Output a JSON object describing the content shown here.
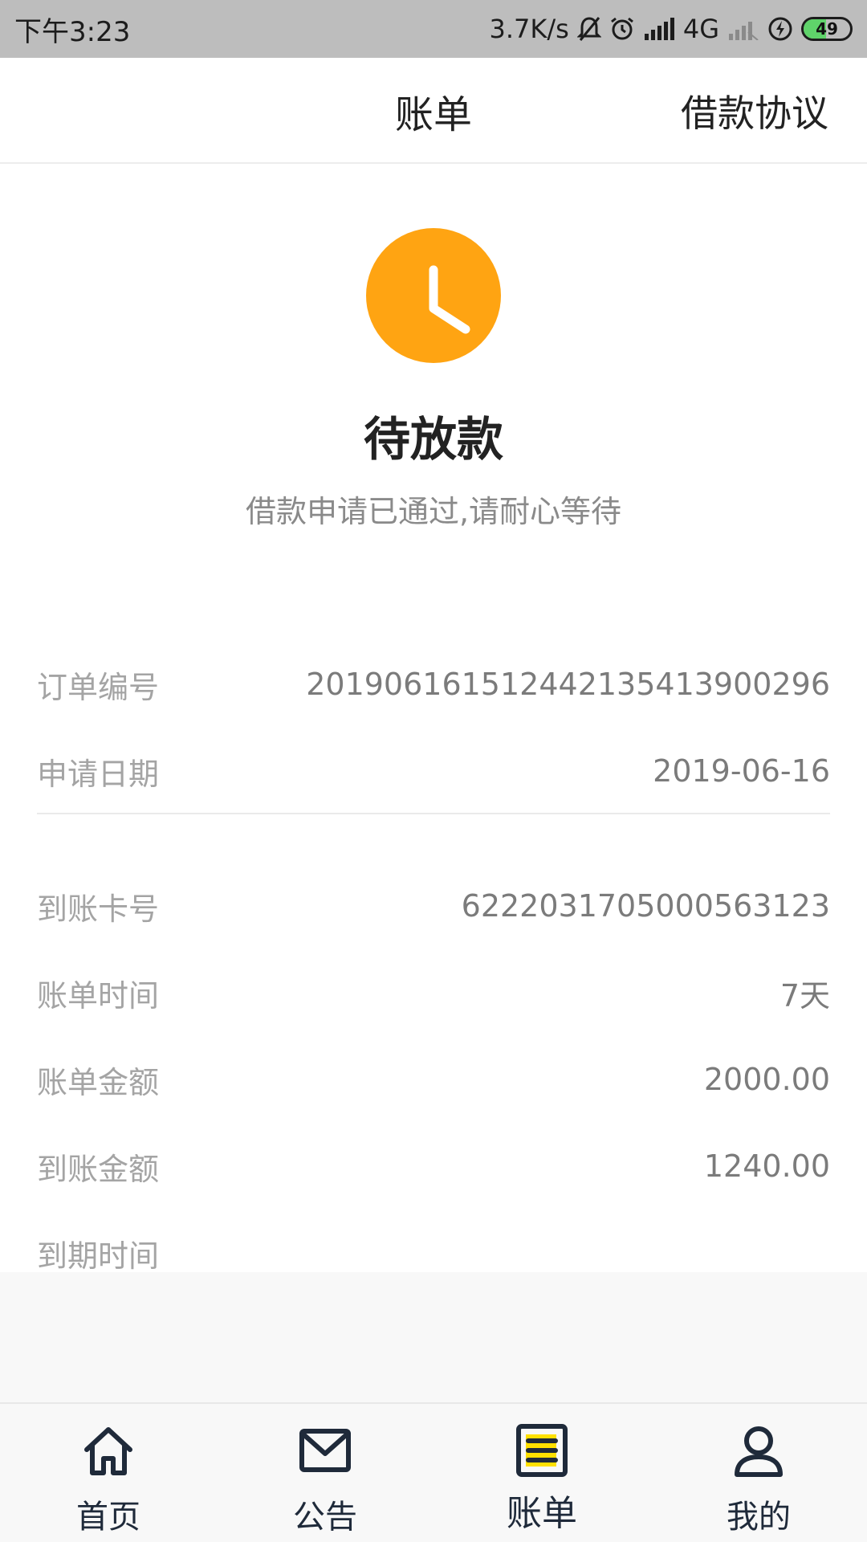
{
  "status_bar": {
    "time": "下午3:23",
    "net_speed": "3.7K/s",
    "network": "4G",
    "battery": "49",
    "battery_level": 0.49
  },
  "header": {
    "title": "账单",
    "link": "借款协议"
  },
  "status": {
    "icon": "clock-icon",
    "icon_color": "#FFA412",
    "title": "待放款",
    "description": "借款申请已通过,请耐心等待"
  },
  "details": [
    {
      "label": "订单编号",
      "value": "201906161512442135413900296"
    },
    {
      "label": "申请日期",
      "value": "2019-06-16"
    },
    {
      "label": "到账卡号",
      "value": "6222031705000563123"
    },
    {
      "label": "账单时间",
      "value": "7天"
    },
    {
      "label": "账单金额",
      "value": "2000.00"
    },
    {
      "label": "到账金额",
      "value": "1240.00"
    },
    {
      "label": "到期时间",
      "value": ""
    }
  ],
  "nav": {
    "items": [
      {
        "label": "首页",
        "icon": "home-icon"
      },
      {
        "label": "公告",
        "icon": "mail-icon"
      },
      {
        "label": "账单",
        "icon": "bill-icon",
        "active": true
      },
      {
        "label": "我的",
        "icon": "user-icon"
      }
    ],
    "active_highlight": "#FFE000"
  }
}
